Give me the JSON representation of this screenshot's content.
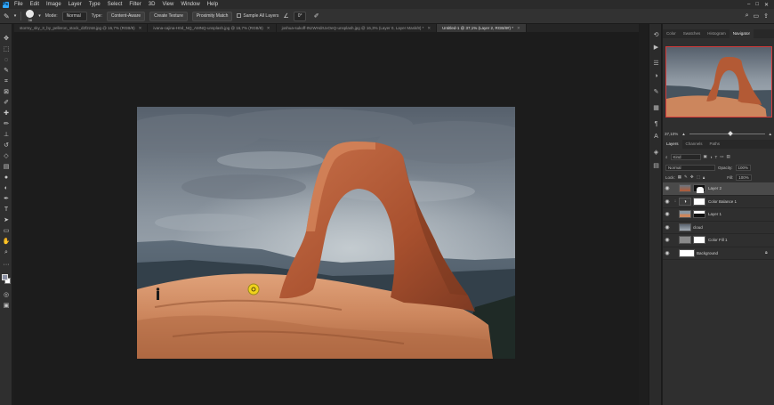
{
  "app": {
    "logo_text": "Ps",
    "menu": [
      "File",
      "Edit",
      "Image",
      "Layer",
      "Type",
      "Select",
      "Filter",
      "3D",
      "View",
      "Window",
      "Help"
    ],
    "window_controls": [
      "–",
      "□",
      "✕"
    ]
  },
  "options_bar": {
    "brush_size": "38",
    "mode_label": "Mode:",
    "mode_value": "Normal",
    "type_label": "Type:",
    "type_content_aware": "Content-Aware",
    "type_create_texture": "Create Texture",
    "type_proximity_match": "Proximity Match",
    "sample_all_layers": "Sample All Layers",
    "angle_value": "0°"
  },
  "tabs": [
    {
      "label": "stormy_sky_3_by_pelleron_stock_d2f2zs8.jpg @ 16,7% (RGB/8)",
      "active": false
    },
    {
      "label": "ivana-cajina-H0d_NQ_AMNQ-unsplash.jpg @ 16,7% (RGB/8)",
      "active": false
    },
    {
      "label": "joshua-sukoff-INzWHdrUxOeQ-unsplash.jpg @ 16,3% (Layer 0, Layer Mask/8) *",
      "active": false
    },
    {
      "label": "Untitled-1 @ 37,1% (Layer 2, RGB/8#) *",
      "active": true
    }
  ],
  "tools": [
    "move-tool",
    "artboard-tool",
    "lasso-tool",
    "quick-select-tool",
    "crop-tool",
    "frame-tool",
    "eyedropper-tool",
    "healing-brush-tool",
    "brush-tool",
    "clone-stamp-tool",
    "history-brush-tool",
    "eraser-tool",
    "gradient-tool",
    "blur-tool",
    "dodge-tool",
    "pen-tool",
    "type-tool",
    "path-select-tool",
    "rectangle-tool",
    "hand-tool",
    "zoom-tool"
  ],
  "panels": {
    "top_tabs": [
      "Color",
      "Swatches",
      "Histogram",
      "Navigator"
    ],
    "top_active": "Navigator",
    "zoom_value": "37,10%",
    "layer_tabs": [
      "Layers",
      "Channels",
      "Paths"
    ],
    "layer_active": "Layers",
    "filter_kind": "Kind",
    "blend_mode": "Normal",
    "opacity_label": "Opacity:",
    "opacity_value": "100%",
    "lock_label": "Lock:",
    "fill_label": "Fill:",
    "fill_value": "100%",
    "layers": [
      {
        "name": "Layer 2",
        "active": true,
        "thumb": "photo",
        "mask": "arch-mask",
        "clip": false,
        "lock": false
      },
      {
        "name": "Color Balance 1",
        "active": false,
        "thumb": "adjust",
        "mask": "white",
        "clip": true,
        "lock": false
      },
      {
        "name": "Layer 1",
        "active": false,
        "thumb": "sky-strip",
        "mask": "dark-strip",
        "clip": false,
        "lock": false
      },
      {
        "name": "cloud",
        "active": false,
        "thumb": "cloud",
        "mask": "",
        "clip": false,
        "lock": false
      },
      {
        "name": "Color Fill 1",
        "active": false,
        "thumb": "fill",
        "mask": "white",
        "clip": false,
        "lock": false
      },
      {
        "name": "Background",
        "active": false,
        "thumb": "white",
        "mask": "",
        "clip": false,
        "lock": true
      }
    ]
  },
  "colors": {
    "accent": "#31a8ff",
    "sky_top": "#5b6470",
    "sky_bottom": "#a3acb4",
    "rock": "#b8603a",
    "sand": "#d6936a"
  }
}
